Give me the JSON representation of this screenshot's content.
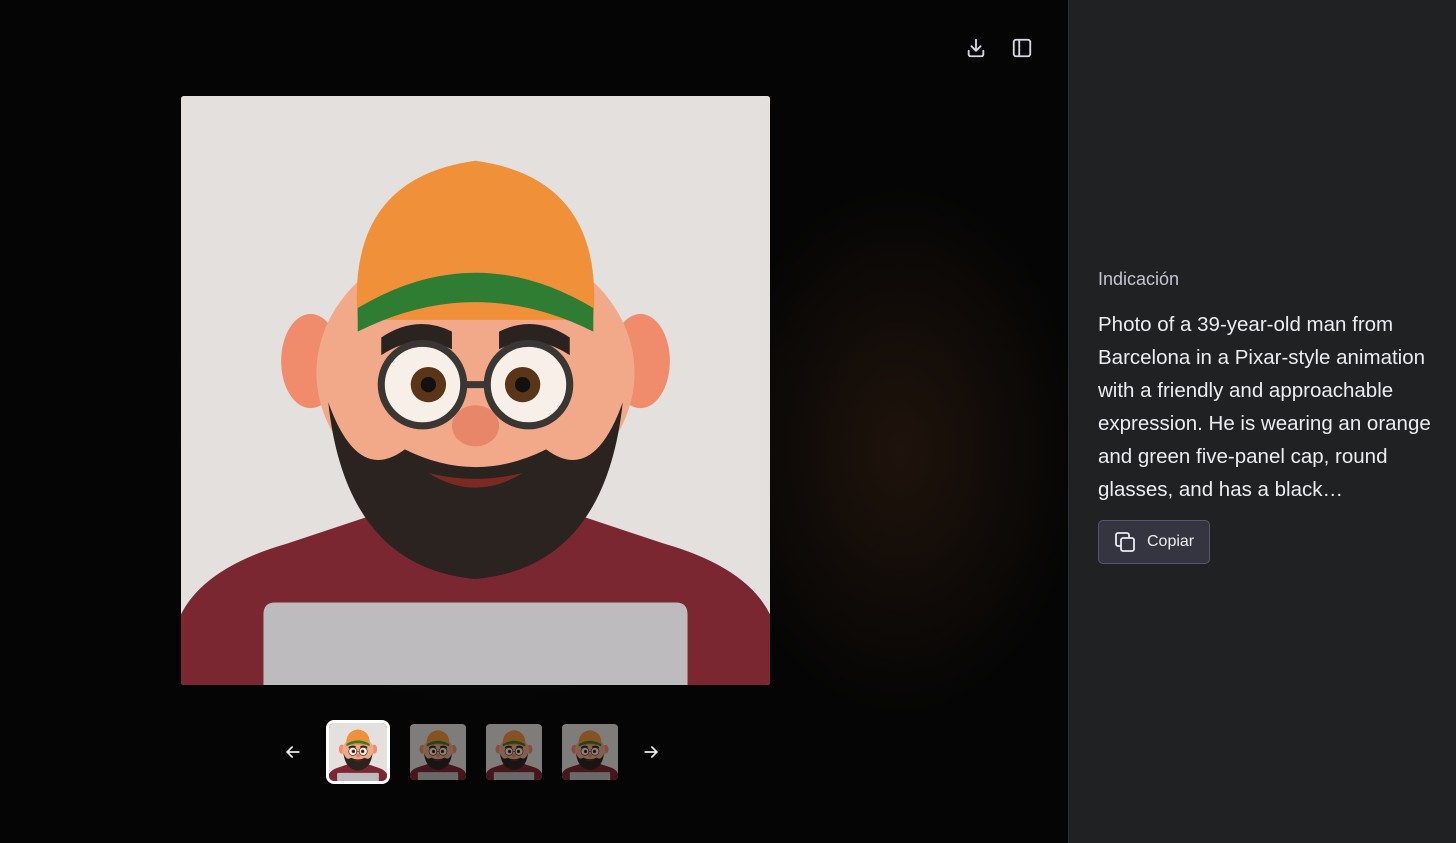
{
  "toolbar": {
    "download_icon": "download-icon",
    "sidebar_toggle_icon": "sidebar-toggle-icon"
  },
  "viewer": {
    "main_image": {
      "subject": "pixar-style-bearded-man-portrait",
      "colors": {
        "background": "#e3e0de",
        "cap": "#f0913a",
        "cap_brim": "#2f7d32",
        "sweater": "#7a2732",
        "skin": "#f2a98a",
        "beard": "#2a2320"
      }
    },
    "thumbnails": [
      {
        "index": 1,
        "selected": true
      },
      {
        "index": 2,
        "selected": false
      },
      {
        "index": 3,
        "selected": false
      },
      {
        "index": 4,
        "selected": false
      }
    ],
    "prev_icon": "arrow-left-icon",
    "next_icon": "arrow-right-icon"
  },
  "sidebar": {
    "prompt_label": "Indicación",
    "prompt_text": "Photo of a 39-year-old man from Barcelona in a Pixar-style animation with a friendly and approachable expression. He is wearing an orange and green five-panel cap, round glasses, and has a black…",
    "copy_label": "Copiar",
    "copy_icon": "copy-icon"
  },
  "colors": {
    "viewer_bg": "#050505",
    "sidebar_bg": "#202123",
    "button_bg": "#343541",
    "button_border": "#565869",
    "text_primary": "#ececf1",
    "text_secondary": "#c5c5d2"
  }
}
